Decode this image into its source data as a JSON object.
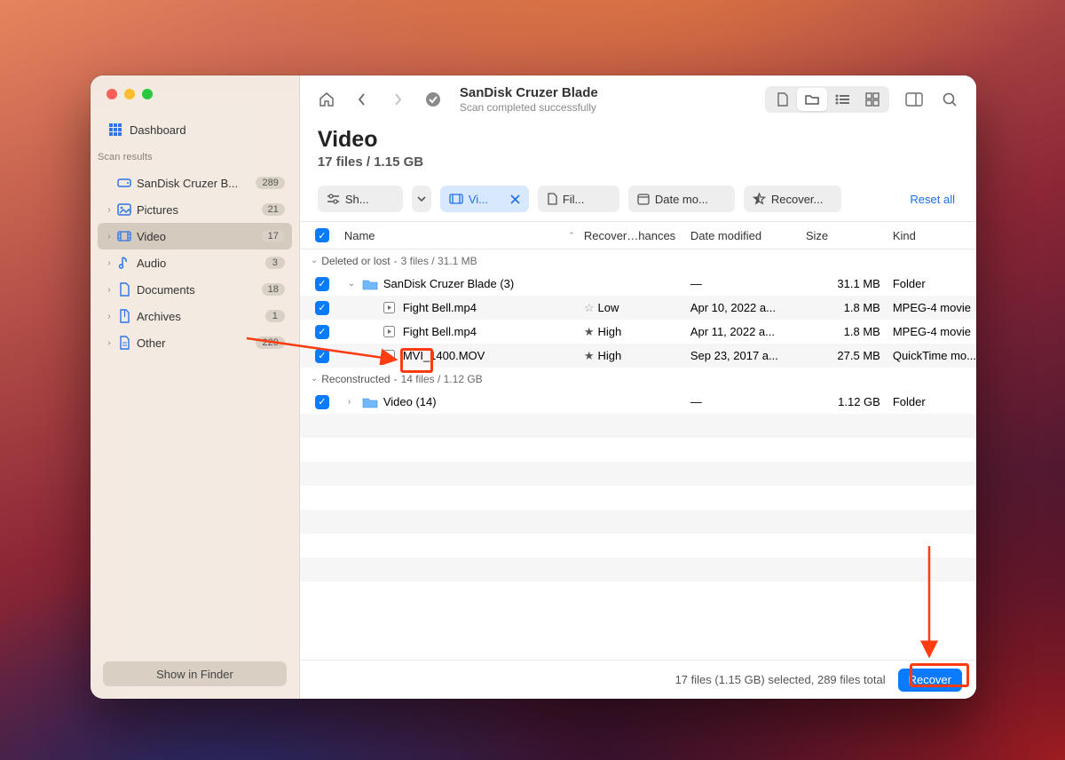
{
  "sidebar": {
    "dashboard": "Dashboard",
    "section_label": "Scan results",
    "device": {
      "label": "SanDisk Cruzer B...",
      "badge": "289"
    },
    "items": [
      {
        "label": "Pictures",
        "badge": "21"
      },
      {
        "label": "Video",
        "badge": "17",
        "active": true
      },
      {
        "label": "Audio",
        "badge": "3"
      },
      {
        "label": "Documents",
        "badge": "18"
      },
      {
        "label": "Archives",
        "badge": "1"
      },
      {
        "label": "Other",
        "badge": "229"
      }
    ],
    "show_in_finder": "Show in Finder"
  },
  "toolbar": {
    "title": "SanDisk Cruzer Blade",
    "subtitle": "Scan completed successfully"
  },
  "heading": {
    "title": "Video",
    "subtitle": "17 files / 1.15 GB"
  },
  "filters": {
    "show": "Sh...",
    "video": "Vi...",
    "file": "Fil...",
    "date": "Date mo...",
    "recover": "Recover...",
    "reset": "Reset all"
  },
  "columns": {
    "name": "Name",
    "recovery": "Recover…hances",
    "date": "Date modified",
    "size": "Size",
    "kind": "Kind"
  },
  "groups": {
    "deleted": {
      "label": "Deleted or lost",
      "meta": "3 files / 31.1 MB"
    },
    "reconstructed": {
      "label": "Reconstructed",
      "meta": "14 files / 1.12 GB"
    }
  },
  "rows": [
    {
      "name": "SanDisk Cruzer Blade (3)",
      "rec": "",
      "date": "—",
      "size": "31.1 MB",
      "kind": "Folder",
      "folder": true,
      "open": true,
      "indent": 0
    },
    {
      "name": "Fight Bell.mp4",
      "rec": "Low",
      "date": "Apr 10, 2022 a...",
      "size": "1.8 MB",
      "kind": "MPEG-4 movie",
      "folder": false,
      "indent": 1,
      "star": "open"
    },
    {
      "name": "Fight Bell.mp4",
      "rec": "High",
      "date": "Apr 11, 2022 a...",
      "size": "1.8 MB",
      "kind": "MPEG-4 movie",
      "folder": false,
      "indent": 1,
      "star": "fill"
    },
    {
      "name": "MVI_1400.MOV",
      "rec": "High",
      "date": "Sep 23, 2017 a...",
      "size": "27.5 MB",
      "kind": "QuickTime mo...",
      "folder": false,
      "indent": 1,
      "star": "fill"
    }
  ],
  "rows2": [
    {
      "name": "Video (14)",
      "rec": "",
      "date": "—",
      "size": "1.12 GB",
      "kind": "Folder",
      "folder": true,
      "open": false,
      "indent": 0
    }
  ],
  "footer": {
    "stats": "17 files (1.15 GB) selected, 289 files total",
    "recover": "Recover"
  }
}
